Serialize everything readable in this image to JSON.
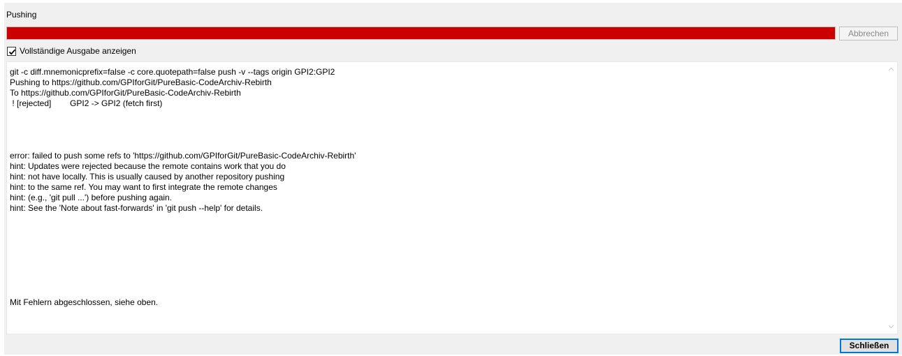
{
  "dialog": {
    "title": "Pushing",
    "progress_fraction": 1.0,
    "progress_color": "#cc0000",
    "cancel_label": "Abbrechen",
    "cancel_enabled": false,
    "show_full_output": {
      "label": "Vollständige Ausgabe anzeigen",
      "checked": true
    },
    "output": {
      "lines": [
        "git -c diff.mnemonicprefix=false -c core.quotepath=false push -v --tags origin GPI2:GPI2",
        "Pushing to https://github.com/GPIforGit/PureBasic-CodeArchiv-Rebirth",
        "To https://github.com/GPIforGit/PureBasic-CodeArchiv-Rebirth",
        " ! [rejected]        GPI2 -> GPI2 (fetch first)",
        "",
        "",
        "",
        "",
        "error: failed to push some refs to 'https://github.com/GPIforGit/PureBasic-CodeArchiv-Rebirth'",
        "hint: Updates were rejected because the remote contains work that you do",
        "hint: not have locally. This is usually caused by another repository pushing",
        "hint: to the same ref. You may want to first integrate the remote changes",
        "hint: (e.g., 'git pull ...') before pushing again.",
        "hint: See the 'Note about fast-forwards' in 'git push --help' for details.",
        "",
        "",
        "",
        "",
        "",
        "",
        "",
        "",
        "Mit Fehlern abgeschlossen, siehe oben."
      ]
    },
    "close_label": "Schließen",
    "icons": {
      "checkbox": "checkmark-icon",
      "scroll_up": "chevron-up-icon",
      "scroll_down": "chevron-down-icon"
    },
    "colors": {
      "accent_focus": "#0078d7",
      "background": "#f0f0f0"
    }
  }
}
